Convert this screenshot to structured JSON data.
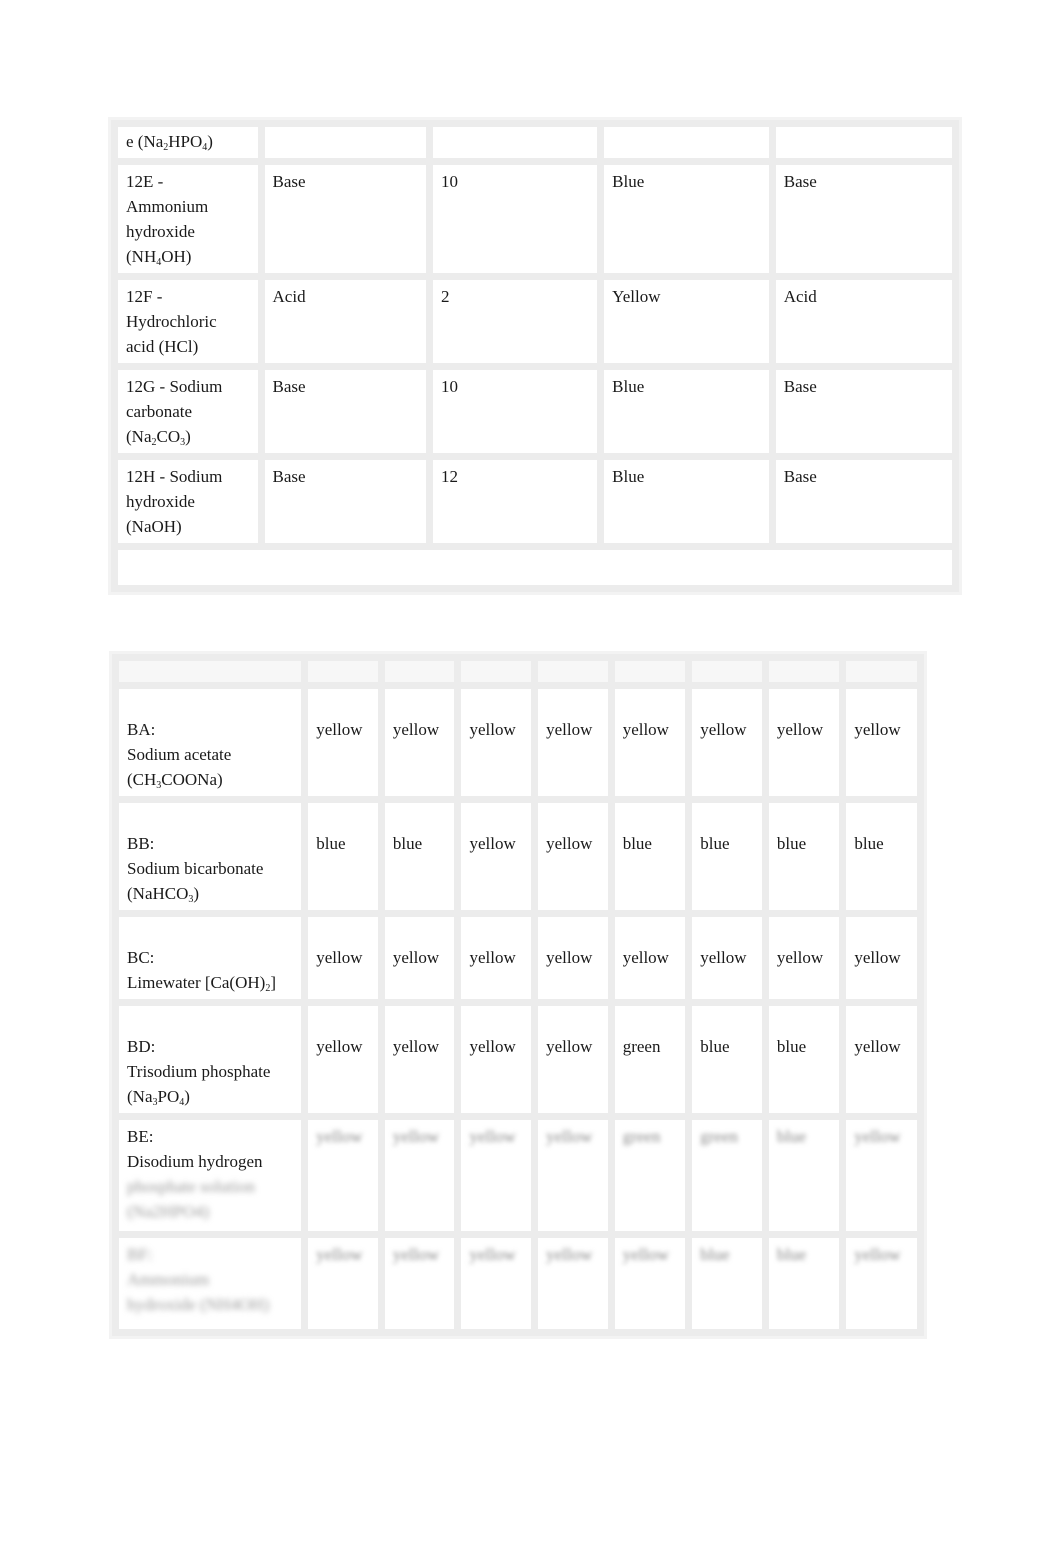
{
  "table1": {
    "partial_row": {
      "substance": "e (Na",
      "sub1": "2",
      "mid": "HPO",
      "sub2": "4",
      "end": ")"
    },
    "rows": [
      {
        "substance_lines": [
          "12E -",
          "Ammonium",
          "hydroxide"
        ],
        "formula_pre": "(NH",
        "formula_sub": "4",
        "formula_post": "OH)",
        "prediction": "Base",
        "ph": "10",
        "color": "Blue",
        "result": "Base"
      },
      {
        "substance_lines": [
          "12F -",
          "Hydrochloric",
          "acid (HCl)"
        ],
        "prediction": "Acid",
        "ph": "2",
        "color": "Yellow",
        "result": "Acid"
      },
      {
        "substance_lines": [
          "12G - Sodium",
          "carbonate"
        ],
        "formula_pre": "(Na",
        "formula_sub": "2",
        "formula_mid": "CO",
        "formula_sub2": "3",
        "formula_post": ")",
        "prediction": "Base",
        "ph": "10",
        "color": "Blue",
        "result": "Base"
      },
      {
        "substance_lines": [
          "12H - Sodium",
          "hydroxide",
          "(NaOH)"
        ],
        "prediction": "Base",
        "ph": "12",
        "color": "Blue",
        "result": "Base"
      }
    ]
  },
  "table2": {
    "rows": [
      {
        "code": "BA:",
        "name": "Sodium acetate",
        "formula_pre": "(CH",
        "formula_sub": "3",
        "formula_post": "COONa)",
        "values": [
          "yellow",
          "yellow",
          "yellow",
          "yellow",
          "yellow",
          "yellow",
          "yellow",
          "yellow"
        ]
      },
      {
        "code": "BB:",
        "name": "Sodium bicarbonate",
        "formula_pre": "(NaHCO",
        "formula_sub": "3",
        "formula_post": ")",
        "values": [
          "blue",
          "blue",
          "yellow",
          "yellow",
          "blue",
          "blue",
          "blue",
          "blue"
        ]
      },
      {
        "code": "BC:",
        "name_pre": "Limewater [Ca(OH)",
        "name_sub": "2",
        "name_post": "]",
        "values": [
          "yellow",
          "yellow",
          "yellow",
          "yellow",
          "yellow",
          "yellow",
          "yellow",
          "yellow"
        ]
      },
      {
        "code": "BD:",
        "name": "Trisodium phosphate",
        "formula_pre": "(Na",
        "formula_sub": "3",
        "formula_mid": "PO",
        "formula_sub2": "4",
        "formula_post": ")",
        "values": [
          "yellow",
          "yellow",
          "yellow",
          "yellow",
          "green",
          "blue",
          "blue",
          "yellow"
        ]
      },
      {
        "code": "BE:",
        "name": "Disodium hydrogen",
        "blurred_lines": [
          "phosphate solution",
          "(Na2HPO4)"
        ],
        "blurred_values": [
          "yellow",
          "yellow",
          "yellow",
          "yellow",
          "green",
          "green",
          "blue",
          "yellow"
        ]
      },
      {
        "blurred_code": "BF:",
        "blurred_lines": [
          "Ammonium",
          "hydroxide (NH4OH)"
        ],
        "blurred_values": [
          "yellow",
          "yellow",
          "yellow",
          "yellow",
          "yellow",
          "blue",
          "blue",
          "yellow"
        ]
      }
    ]
  }
}
